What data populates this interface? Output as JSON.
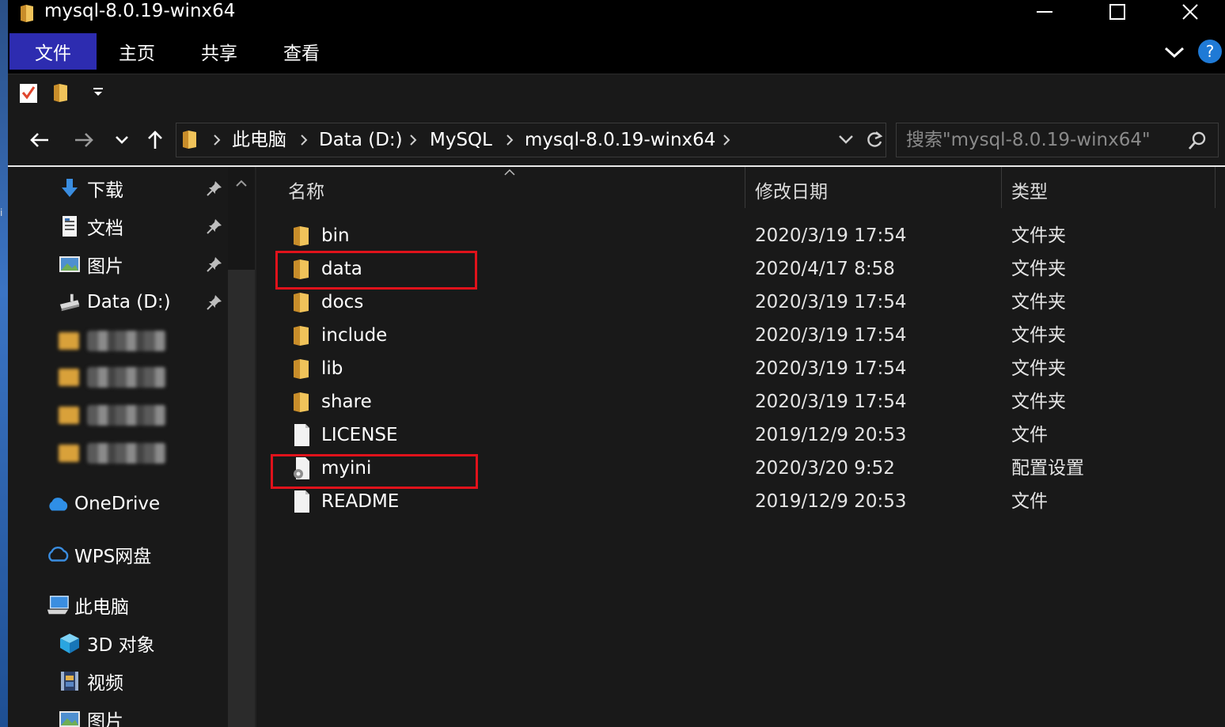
{
  "window": {
    "title": "mysql-8.0.19-winx64",
    "minimize_glyph": "—",
    "close_glyph": "✕"
  },
  "ribbon": {
    "tabs": [
      {
        "label": "文件",
        "active": true
      },
      {
        "label": "主页"
      },
      {
        "label": "共享"
      },
      {
        "label": "查看"
      }
    ],
    "help_label": "?"
  },
  "address": {
    "crumbs": [
      "此电脑",
      "Data (D:)",
      "MySQL",
      "mysql-8.0.19-winx64"
    ]
  },
  "search": {
    "placeholder": "搜索\"mysql-8.0.19-winx64\""
  },
  "nav": {
    "quick_access": [
      {
        "label": "下载",
        "icon": "download-icon",
        "pinned": true
      },
      {
        "label": "文档",
        "icon": "document-icon",
        "pinned": true
      },
      {
        "label": "图片",
        "icon": "picture-icon",
        "pinned": true
      },
      {
        "label": "Data (D:)",
        "icon": "drive-icon",
        "pinned": true
      }
    ],
    "onedrive": "OneDrive",
    "wps": "WPS网盘",
    "this_pc": "此电脑",
    "pc_items": [
      {
        "label": "3D 对象",
        "icon": "3d-objects-icon"
      },
      {
        "label": "视频",
        "icon": "video-icon"
      },
      {
        "label": "图片",
        "icon": "picture-icon"
      }
    ]
  },
  "columns": {
    "name": "名称",
    "date": "修改日期",
    "type": "类型"
  },
  "files": [
    {
      "name": "bin",
      "date": "2020/3/19 17:54",
      "type": "文件夹",
      "icon": "folder-icon"
    },
    {
      "name": "data",
      "date": "2020/4/17 8:58",
      "type": "文件夹",
      "icon": "folder-icon",
      "highlighted": true
    },
    {
      "name": "docs",
      "date": "2020/3/19 17:54",
      "type": "文件夹",
      "icon": "folder-icon"
    },
    {
      "name": "include",
      "date": "2020/3/19 17:54",
      "type": "文件夹",
      "icon": "folder-icon"
    },
    {
      "name": "lib",
      "date": "2020/3/19 17:54",
      "type": "文件夹",
      "icon": "folder-icon"
    },
    {
      "name": "share",
      "date": "2020/3/19 17:54",
      "type": "文件夹",
      "icon": "folder-icon"
    },
    {
      "name": "LICENSE",
      "date": "2019/12/9 20:53",
      "type": "文件",
      "icon": "file-icon"
    },
    {
      "name": "myini",
      "date": "2020/3/20 9:52",
      "type": "配置设置",
      "icon": "config-file-icon",
      "highlighted": true
    },
    {
      "name": "README",
      "date": "2019/12/9 20:53",
      "type": "文件",
      "icon": "file-icon"
    }
  ],
  "colors": {
    "active_tab": "#2d2cb0",
    "highlight_box": "#e0121b",
    "folder": "#e8b64a"
  }
}
